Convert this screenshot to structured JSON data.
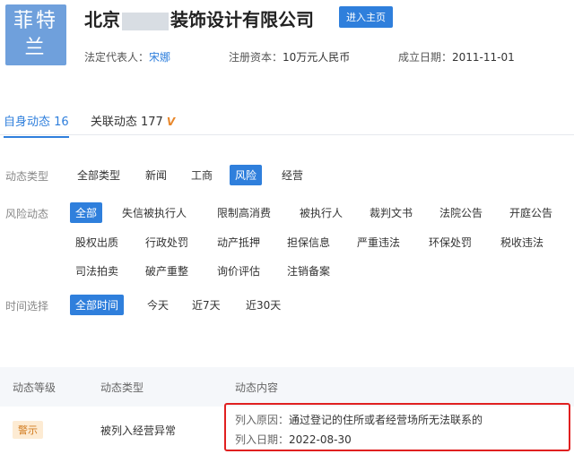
{
  "header": {
    "logo_line1": "菲特",
    "logo_line2": "兰",
    "company_part1": "北京",
    "company_part2": "装饰设计有限公司",
    "home_button": "进入主页",
    "legal_rep_label": "法定代表人：",
    "legal_rep_value": "宋娜",
    "capital_label": "注册资本：",
    "capital_value": "10万元人民币",
    "founded_label": "成立日期：",
    "founded_value": "2011-11-01"
  },
  "tabs": {
    "own_label": "自身动态",
    "own_count": "16",
    "related_label": "关联动态",
    "related_count": "177",
    "vip_mark": "V"
  },
  "filters": {
    "type_label": "动态类型",
    "type_options": [
      "全部类型",
      "新闻",
      "工商",
      "风险",
      "经营"
    ],
    "type_selected": "风险",
    "risk_label": "风险动态",
    "risk_options": [
      "全部",
      "失信被执行人",
      "限制高消费",
      "被执行人",
      "裁判文书",
      "法院公告",
      "开庭公告",
      "股权出质",
      "行政处罚",
      "动产抵押",
      "担保信息",
      "严重违法",
      "环保处罚",
      "税收违法",
      "司法拍卖",
      "破产重整",
      "询价评估",
      "注销备案"
    ],
    "risk_selected": "全部",
    "time_label": "时间选择",
    "time_options": [
      "全部时间",
      "今天",
      "近7天",
      "近30天"
    ],
    "time_selected": "全部时间"
  },
  "table": {
    "headers": [
      "动态等级",
      "动态类型",
      "动态内容"
    ],
    "row": {
      "level": "警示",
      "type": "被列入经营异常",
      "reason_label": "列入原因：",
      "reason_value": "通过登记的住所或者经营场所无法联系的",
      "date_label": "列入日期：",
      "date_value": "2022-08-30"
    }
  },
  "colors": {
    "accent": "#2f7fdc",
    "highlight_border": "#e02020",
    "badge": "#d17b1f"
  }
}
